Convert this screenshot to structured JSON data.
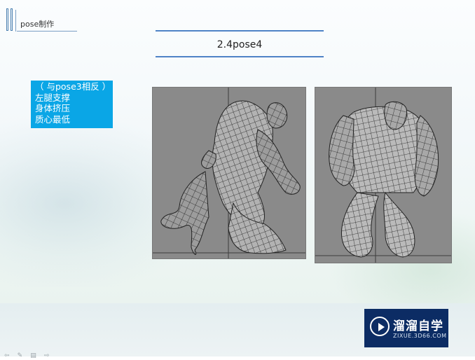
{
  "header": {
    "corner_title": "pose制作",
    "slide_title": "2.4pose4"
  },
  "note": {
    "lines": [
      "（ 与pose3相反 ）",
      "左腿支撑",
      "身体挤压",
      "质心最低"
    ]
  },
  "images": {
    "left": "wireframe-monster-side-view",
    "right": "wireframe-monster-front-view"
  },
  "controls": {
    "prev": "⇦",
    "pen": "✎",
    "menu": "▤",
    "next": "⇨"
  },
  "watermark": {
    "name": "溜溜自学",
    "url": "ZIXUE.3D66.COM",
    "bg_color": "#0c2c64"
  },
  "colors": {
    "accent": "#0aa6e6",
    "title_line": "#4f83c6"
  }
}
